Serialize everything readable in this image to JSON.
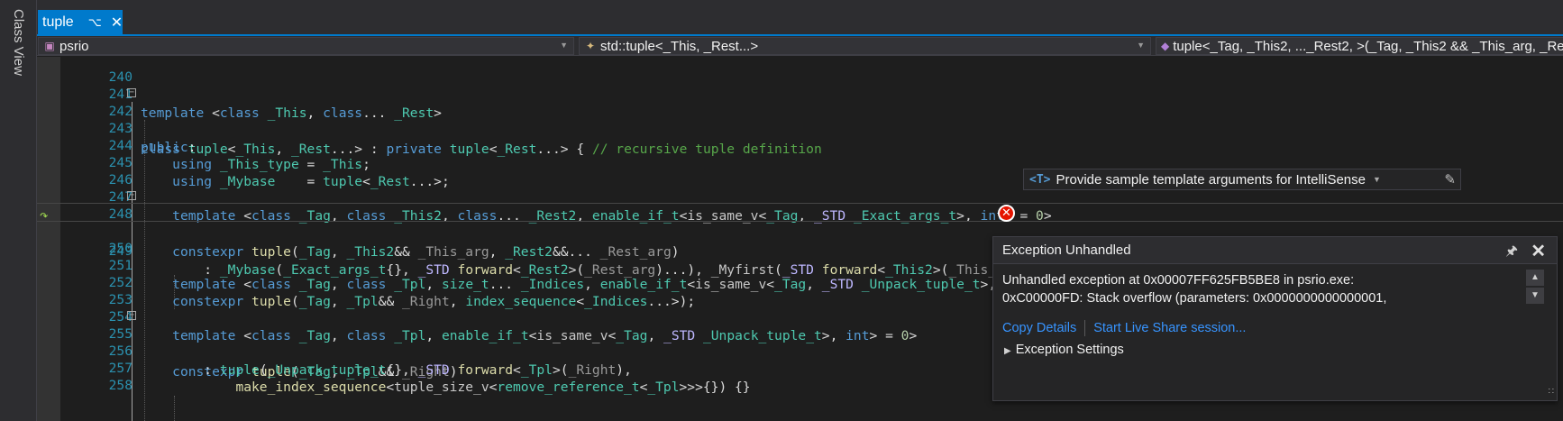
{
  "side_panel": {
    "label": "Class View"
  },
  "tab": {
    "label": "tuple",
    "pin_icon": "pin-icon",
    "close_icon": "close-icon"
  },
  "navbar": {
    "project": "psrio",
    "scope": "std::tuple<_This, _Rest...>",
    "member": "tuple<_Tag, _This2, ..._Rest2, >(_Tag, _This2 && _This_arg, _Rest2 && ..."
  },
  "hint": {
    "badge": "<T>",
    "text": "Provide sample template arguments for IntelliSense"
  },
  "exception": {
    "title": "Exception Unhandled",
    "message_line1": "Unhandled exception at 0x00007FF625FB5BE8 in psrio.exe:",
    "message_line2": "0xC00000FD: Stack overflow (parameters: 0x0000000000000001,",
    "copy_details": "Copy Details",
    "live_share": "Start Live Share session...",
    "settings": "Exception Settings"
  },
  "code": {
    "line_numbers": [
      "240",
      "241",
      "242",
      "243",
      "244",
      "245",
      "246",
      "247",
      "248",
      "249",
      "250",
      "251",
      "252",
      "253",
      "254",
      "255",
      "256",
      "257",
      "258"
    ],
    "current_line": "249"
  },
  "colors": {
    "accent": "#007acc",
    "editor_bg": "#1e1e1e",
    "keyword": "#569cd6",
    "type": "#4ec9b0",
    "comment": "#57a64a",
    "error": "#e51400",
    "link": "#3794ff"
  }
}
